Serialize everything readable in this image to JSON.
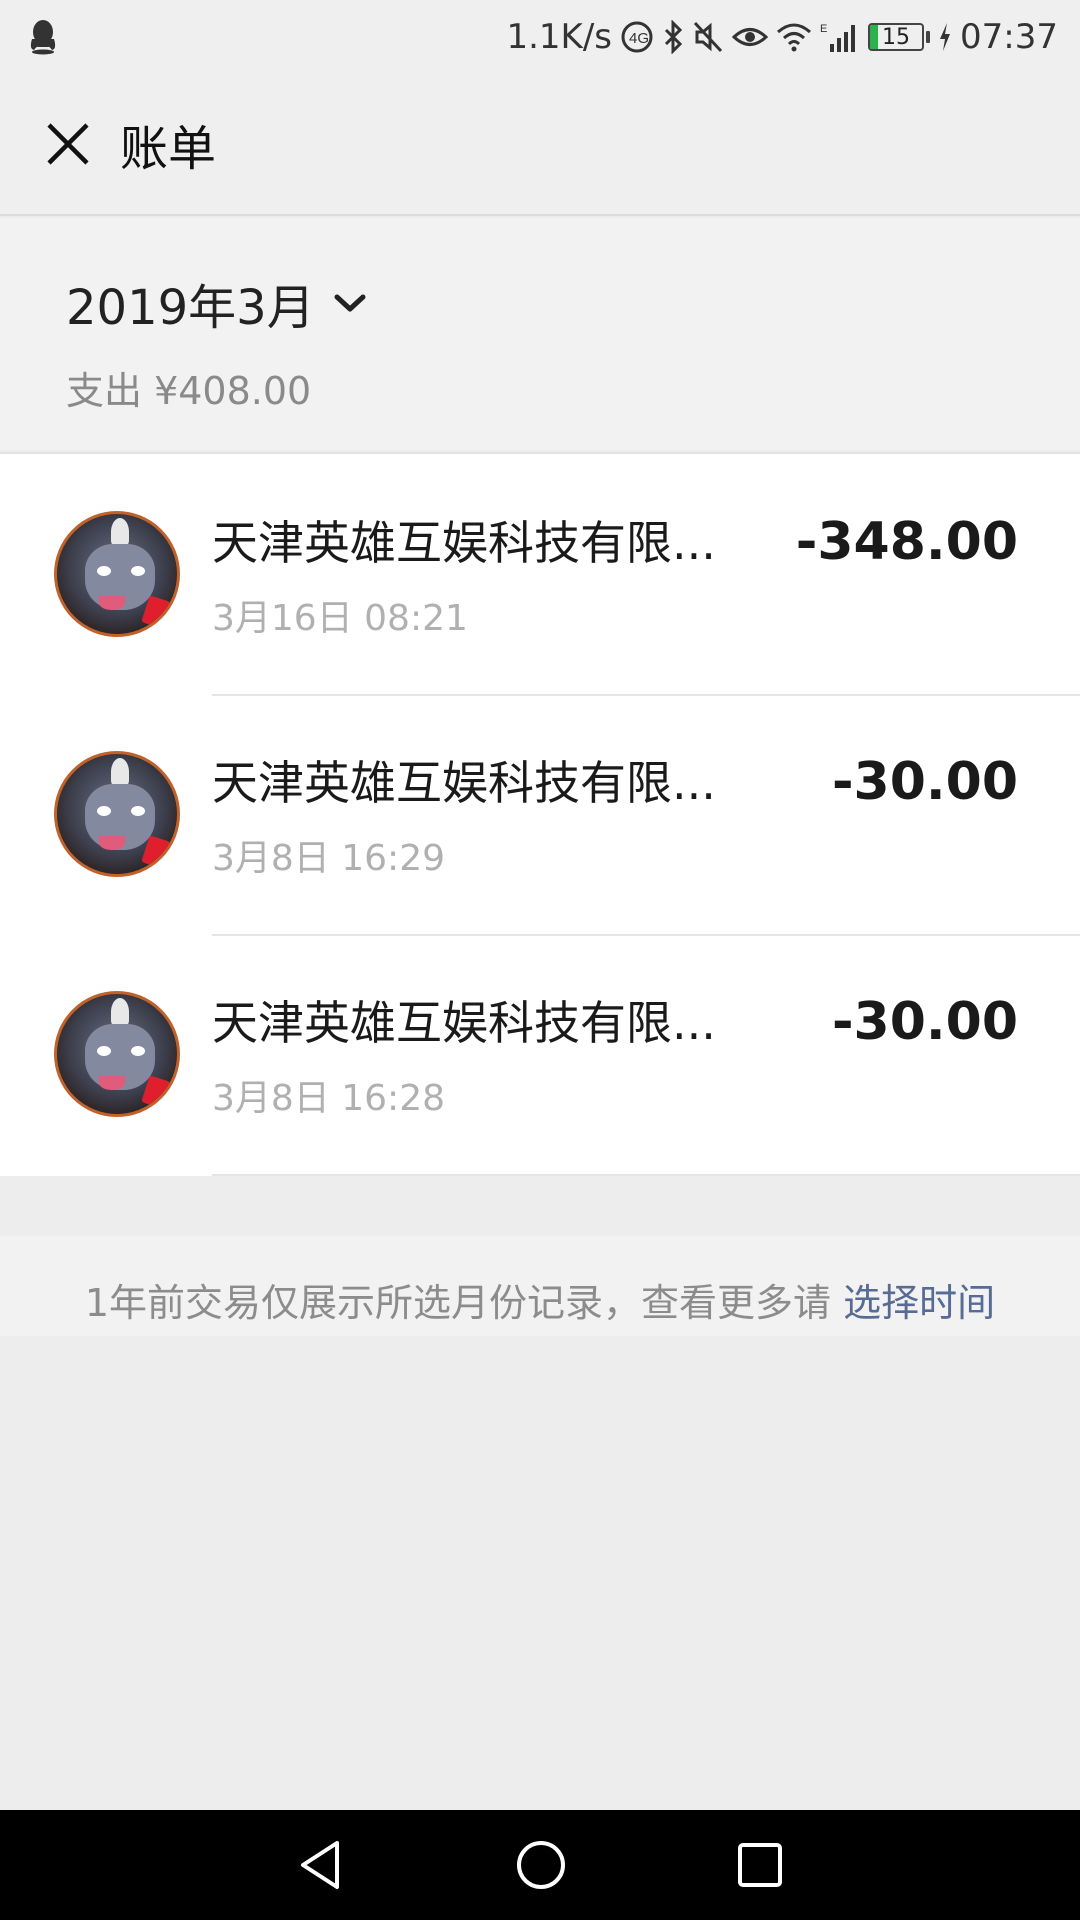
{
  "status_bar": {
    "network_speed": "1.1K/s",
    "battery_level": "15",
    "battery_fraction": 0.15,
    "time": "07:37",
    "icons": [
      "qq-icon",
      "hd-call-icon",
      "bluetooth-icon",
      "mute-icon",
      "eye-comfort-icon",
      "wifi-icon",
      "signal-icon",
      "battery-icon",
      "charging-icon"
    ]
  },
  "header": {
    "title": "账单",
    "close_icon": "close-icon"
  },
  "summary": {
    "month": "2019年3月",
    "expense": "支出 ¥408.00"
  },
  "transactions": [
    {
      "merchant": "天津英雄互娱科技有限...",
      "time": "3月16日 08:21",
      "amount": "-348.00"
    },
    {
      "merchant": "天津英雄互娱科技有限...",
      "time": "3月8日 16:29",
      "amount": "-30.00"
    },
    {
      "merchant": "天津英雄互娱科技有限...",
      "time": "3月8日 16:28",
      "amount": "-30.00"
    }
  ],
  "note": {
    "text": "1年前交易仅展示所选月份记录，查看更多请",
    "link": "选择时间"
  },
  "nav_bar": {
    "icons": [
      "back-icon",
      "home-icon",
      "recents-icon"
    ]
  },
  "colors": {
    "link": "#576b95",
    "battery": "#2bb24c"
  }
}
